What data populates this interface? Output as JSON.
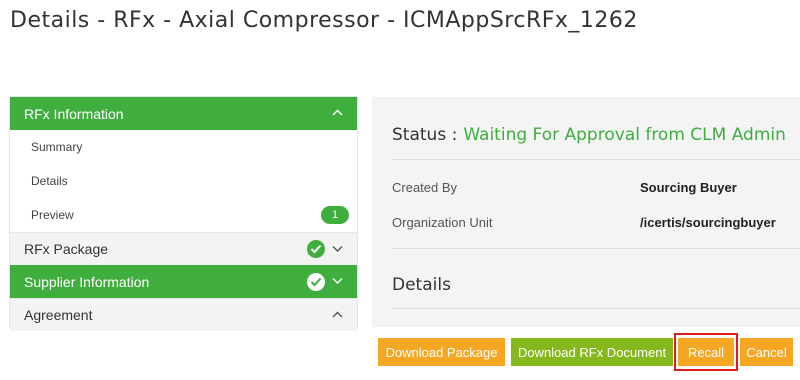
{
  "page": {
    "title": "Details - RFx - Axial Compressor - ICMAppSrcRFx_1262"
  },
  "sidebar": {
    "sections": [
      {
        "label": "RFx Information",
        "items": [
          {
            "label": "Summary"
          },
          {
            "label": "Details"
          },
          {
            "label": "Preview",
            "badge": "1"
          }
        ]
      },
      {
        "label": "RFx Package"
      },
      {
        "label": "Supplier Information"
      },
      {
        "label": "Agreement"
      }
    ]
  },
  "details": {
    "status_label": "Status :",
    "status_value": "Waiting For Approval from CLM Admin",
    "fields": [
      {
        "label": "Created By",
        "value": "Sourcing Buyer"
      },
      {
        "label": "Organization Unit",
        "value": "/icertis/sourcingbuyer"
      }
    ],
    "section_heading": "Details"
  },
  "actions": {
    "download_package": "Download Package",
    "download_rfx_document": "Download RFx Document",
    "recall": "Recall",
    "cancel": "Cancel"
  },
  "colors": {
    "accent_green": "#3fae3f",
    "button_orange": "#f5a623",
    "button_green": "#86b81e",
    "highlight_red": "#e01b24"
  },
  "icons": {
    "chevron_up": "chevron-up-icon",
    "chevron_down": "chevron-down-icon",
    "check": "check-circle-icon"
  }
}
